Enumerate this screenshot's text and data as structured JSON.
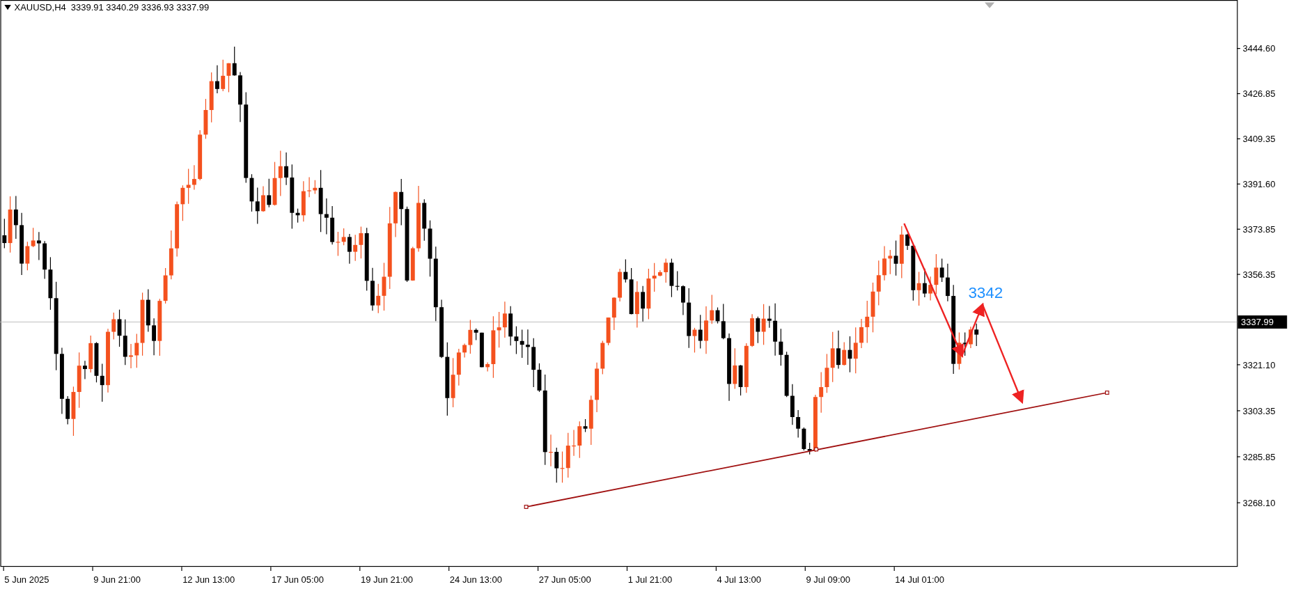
{
  "chart": {
    "symbol": "XAUUSD,H4",
    "ohlc": "3339.91 3340.29 3336.93 3337.99",
    "price_labels": [
      "3444.60",
      "3426.85",
      "3409.35",
      "3391.60",
      "3373.85",
      "3356.35",
      "3321.10",
      "3303.35",
      "3285.85",
      "3268.10"
    ],
    "current_price": "3337.99",
    "time_labels": [
      "5 Jun 2025",
      "9 Jun 21:00",
      "12 Jun 13:00",
      "17 Jun 05:00",
      "19 Jun 21:00",
      "24 Jun 13:00",
      "27 Jun 05:00",
      "1 Jul 21:00",
      "4 Jul 13:00",
      "9 Jul 09:00",
      "14 Jul 01:00"
    ],
    "annotation": "3342"
  }
}
